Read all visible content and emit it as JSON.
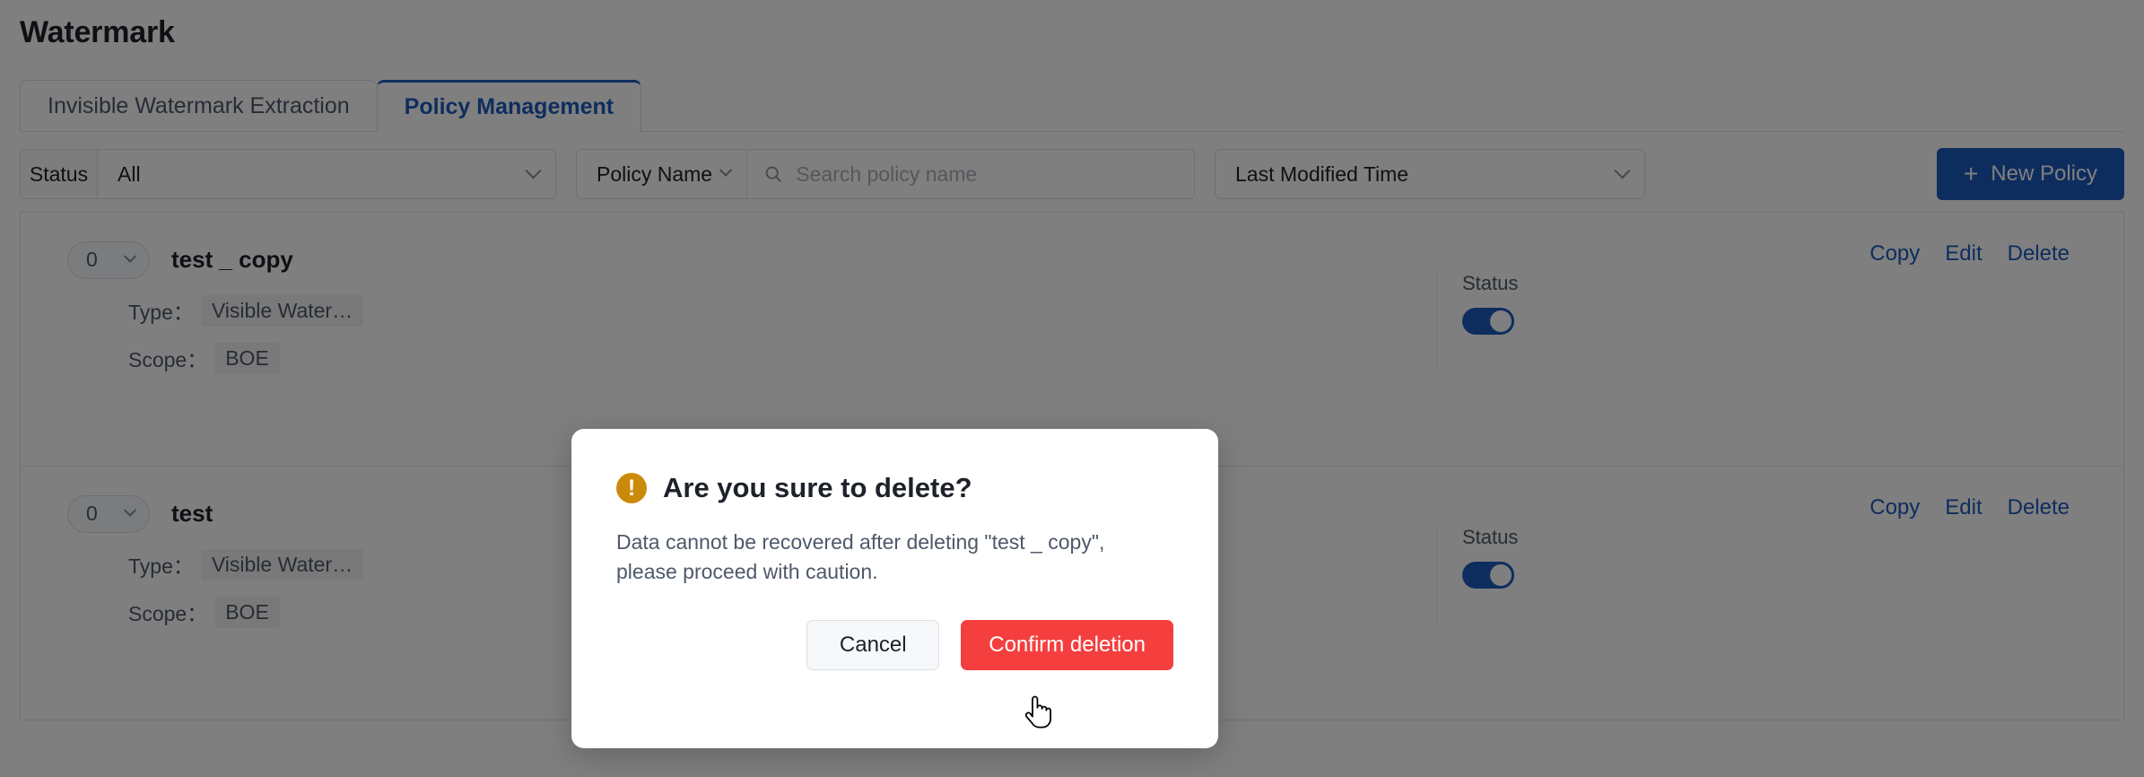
{
  "page": {
    "title": "Watermark"
  },
  "tabs": [
    {
      "label": "Invisible Watermark Extraction",
      "active": false
    },
    {
      "label": "Policy Management",
      "active": true
    }
  ],
  "filter_bar": {
    "status_label": "Status",
    "status_value": "All",
    "field_value": "Policy Name",
    "search_placeholder": "Search policy name",
    "search_value": "",
    "sort_value": "Last Modified Time",
    "new_policy_label": "New Policy",
    "new_policy_plus": "+",
    "search_icon": "search-icon",
    "chevron_icon": "chevron-down-icon"
  },
  "policies": [
    {
      "count": "0",
      "name": "test _ copy",
      "type_label": "Type：",
      "type_value": "Visible Water…",
      "scope_label": "Scope：",
      "scope_value": "BOE",
      "status_caption": "Status",
      "status_on": true,
      "actions": {
        "copy": "Copy",
        "edit": "Edit",
        "delete": "Delete"
      }
    },
    {
      "count": "0",
      "name": "test",
      "type_label": "Type：",
      "type_value": "Visible Water…",
      "scope_label": "Scope：",
      "scope_value": "BOE",
      "status_caption": "Status",
      "status_on": true,
      "actions": {
        "copy": "Copy",
        "edit": "Edit",
        "delete": "Delete"
      }
    }
  ],
  "modal": {
    "icon": "warning-icon",
    "icon_glyph": "!",
    "title": "Are you sure to delete?",
    "message": "Data cannot be recovered after deleting \"test _ copy\", please proceed with caution.",
    "cancel_label": "Cancel",
    "confirm_label": "Confirm deletion"
  },
  "colors": {
    "accent_blue": "#1d5bbf",
    "danger_red": "#f53f3f",
    "warning_amber": "#cc8a0a",
    "text_primary": "#1d2129",
    "text_secondary": "#4e5969",
    "border": "#e5e6eb"
  },
  "cursor": {
    "icon": "pointer-hand-cursor"
  }
}
